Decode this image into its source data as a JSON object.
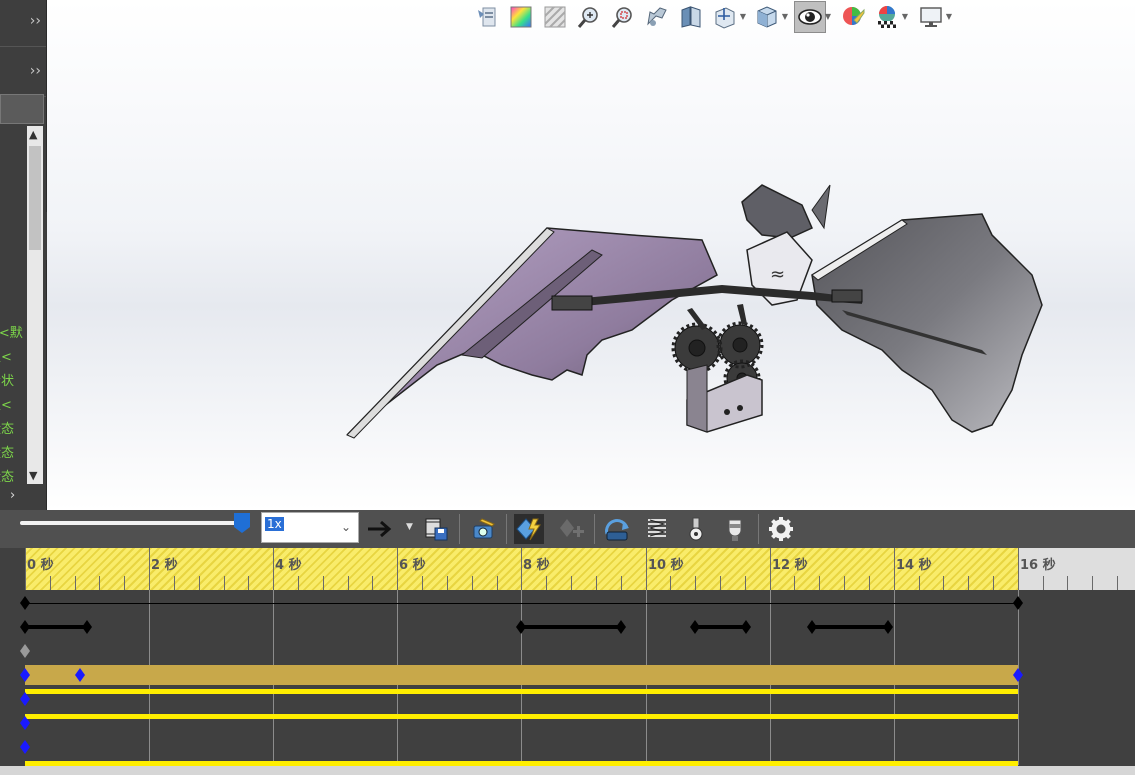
{
  "left_panel": {
    "tree_lines": [
      "))",
      "<<默",
      "认<",
      "示状",
      "认<",
      "状态",
      "状态",
      "状态"
    ]
  },
  "heads_up_toolbar": {
    "icons": [
      "view-settings-icon",
      "appearance-icon",
      "section-view-icon",
      "zoom-to-fit-icon",
      "zoom-to-area-icon",
      "previous-view-icon",
      "section-cut-icon",
      "view-orientation-icon",
      "display-style-icon",
      "hide-show-items-icon",
      "edit-appearance-icon",
      "apply-scene-icon",
      "view-settings-monitor-icon"
    ]
  },
  "motion_toolbar": {
    "speed_value": "1x",
    "icons": [
      "playback-mode-icon",
      "save-animation-icon",
      "animation-wizard-icon",
      "autokey-icon",
      "add-key-icon",
      "motor-icon",
      "spring-icon",
      "contact-icon",
      "gravity-icon",
      "results-icon",
      "motion-study-properties-icon"
    ]
  },
  "timeline": {
    "ticks": [
      "0 秒",
      "2 秒",
      "4 秒",
      "6 秒",
      "8 秒",
      "10 秒",
      "12 秒",
      "14 秒",
      "16 秒"
    ]
  },
  "colors": {
    "ruler_yellow": "#f9ec6a",
    "timeline_bg": "#404040",
    "gold_band": "#c8a84a",
    "yellow_line": "#ffee00",
    "key_blue": "#1a1aff",
    "tree_green": "#7dd64a"
  }
}
